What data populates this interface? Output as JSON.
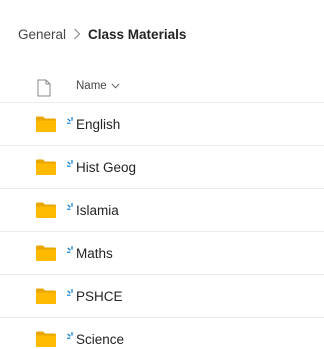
{
  "breadcrumb": {
    "root": "General",
    "current": "Class Materials"
  },
  "list_header": {
    "name_column": "Name",
    "file_type_icon": "document-icon",
    "sort_icon": "chevron-down-icon"
  },
  "folders": [
    {
      "name": "English",
      "icon": "folder-icon",
      "status_icon": "new-item-sparkle-icon"
    },
    {
      "name": "Hist Geog",
      "icon": "folder-icon",
      "status_icon": "new-item-sparkle-icon"
    },
    {
      "name": "Islamia",
      "icon": "folder-icon",
      "status_icon": "new-item-sparkle-icon"
    },
    {
      "name": "Maths",
      "icon": "folder-icon",
      "status_icon": "new-item-sparkle-icon"
    },
    {
      "name": "PSHCE",
      "icon": "folder-icon",
      "status_icon": "new-item-sparkle-icon"
    },
    {
      "name": "Science",
      "icon": "folder-icon",
      "status_icon": "new-item-sparkle-icon"
    }
  ],
  "colors": {
    "folder": "#FFB900",
    "folder_dark": "#E8A600",
    "sync_accent": "#0078D4",
    "divider": "#EDEBE9",
    "text": "#252423"
  }
}
